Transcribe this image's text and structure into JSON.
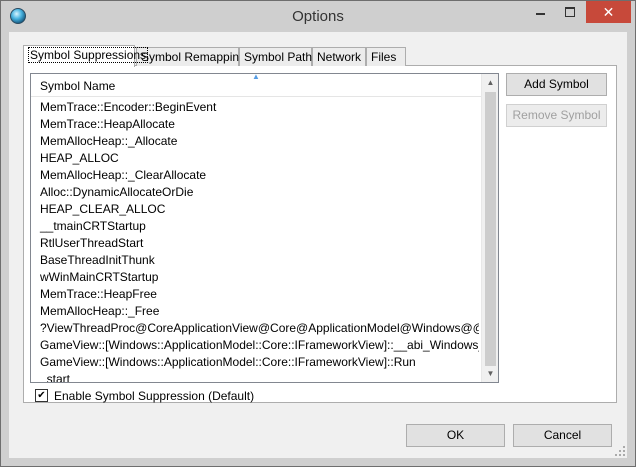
{
  "window": {
    "title": "Options",
    "close_glyph": "✕"
  },
  "tabs": [
    {
      "label": "Symbol Suppressions",
      "active": true
    },
    {
      "label": "Symbol Remapping",
      "active": false
    },
    {
      "label": "Symbol Paths",
      "active": false
    },
    {
      "label": "Network",
      "active": false
    },
    {
      "label": "Files",
      "active": false
    }
  ],
  "list": {
    "column_header": "Symbol Name",
    "rows": [
      "MemTrace::Encoder::BeginEvent",
      "MemTrace::HeapAllocate",
      "MemAllocHeap::_Allocate",
      "HEAP_ALLOC",
      "MemAllocHeap::_ClearAllocate",
      "Alloc::DynamicAllocateOrDie",
      "HEAP_CLEAR_ALLOC",
      "__tmainCRTStartup",
      "RtlUserThreadStart",
      "BaseThreadInitThunk",
      "wWinMainCRTStartup",
      "MemTrace::HeapFree",
      "MemAllocHeap::_Free",
      "?ViewThreadProc@CoreApplicationView@Core@ApplicationModel@Windows@@CAKP...",
      "GameView::[Windows::ApplicationModel::Core::IFrameworkView]::__abi_Windows_Applica...",
      "GameView::[Windows::ApplicationModel::Core::IFrameworkView]::Run",
      "_start"
    ]
  },
  "buttons": {
    "add_symbol": "Add Symbol",
    "remove_symbol": "Remove Symbol",
    "ok": "OK",
    "cancel": "Cancel"
  },
  "checkbox": {
    "label": "Enable Symbol Suppression (Default)",
    "checked": true,
    "check_glyph": "✔"
  }
}
